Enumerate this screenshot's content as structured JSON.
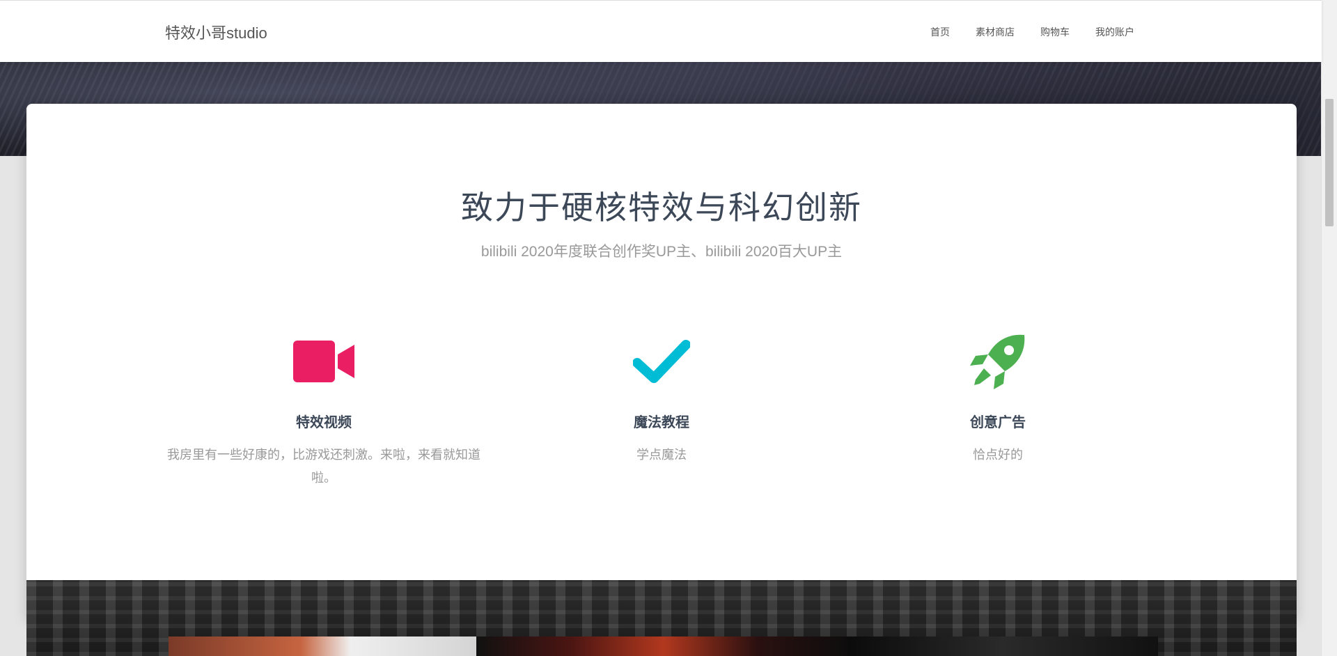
{
  "brand": {
    "name": "特效小哥studio"
  },
  "nav": {
    "items": [
      "首页",
      "素材商店",
      "购物车",
      "我的账户"
    ]
  },
  "intro": {
    "title": "致力于硬核特效与科幻创新",
    "subtitle": "bilibili 2020年度联合创作奖UP主、bilibili 2020百大UP主"
  },
  "features": [
    {
      "icon": "video-camera-icon",
      "color": "#e91e63",
      "title": "特效视频",
      "description": "我房里有一些好康的，比游戏还刺激。来啦，来看就知道啦。"
    },
    {
      "icon": "checkmark-icon",
      "color": "#00bcd4",
      "title": "魔法教程",
      "description": "学点魔法"
    },
    {
      "icon": "rocket-icon",
      "color": "#4caf50",
      "title": "创意广告",
      "description": "恰点好的"
    }
  ]
}
